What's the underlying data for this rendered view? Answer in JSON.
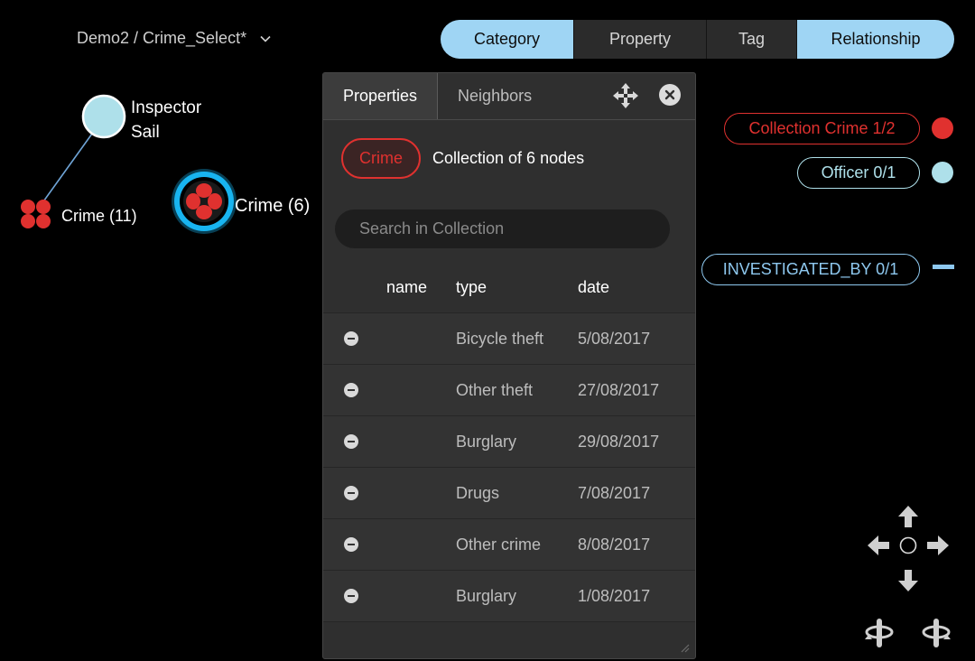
{
  "breadcrumb": {
    "text": "Demo2 / Crime_Select*"
  },
  "topbar": {
    "tabs": [
      {
        "label": "Category",
        "active": true
      },
      {
        "label": "Property",
        "active": false
      },
      {
        "label": "Tag",
        "active": false
      },
      {
        "label": "Relationship",
        "active": true
      }
    ]
  },
  "graph": {
    "inspector_line1": "Inspector",
    "inspector_line2": "Sail",
    "crime_group_label": "Crime (11)",
    "crime_selected_label": "Crime (6)"
  },
  "panel": {
    "tabs": [
      {
        "label": "Properties",
        "active": true
      },
      {
        "label": "Neighbors",
        "active": false
      }
    ],
    "category_pill": "Crime",
    "collection_text": "Collection of 6 nodes",
    "search_placeholder": "Search in Collection",
    "columns": {
      "name": "name",
      "type": "type",
      "date": "date"
    },
    "rows": [
      {
        "name": "",
        "type": "Bicycle theft",
        "date": "5/08/2017"
      },
      {
        "name": "",
        "type": "Other theft",
        "date": "27/08/2017"
      },
      {
        "name": "",
        "type": "Burglary",
        "date": "29/08/2017"
      },
      {
        "name": "",
        "type": "Drugs",
        "date": "7/08/2017"
      },
      {
        "name": "",
        "type": "Other crime",
        "date": "8/08/2017"
      },
      {
        "name": "",
        "type": "Burglary",
        "date": "1/08/2017"
      }
    ]
  },
  "legend": {
    "crime": {
      "label": "Collection Crime 1/2",
      "color": "#e0312f"
    },
    "officer": {
      "label": "Officer 0/1",
      "color": "#aee0ea"
    },
    "relationship": {
      "label": "INVESTIGATED_BY 0/1",
      "color": "#8ec8ef"
    }
  },
  "colors": {
    "accent": "#9fd5f4",
    "crime": "#e0312f",
    "officer": "#aee0ea",
    "selection_ring": "#18b4f0"
  },
  "icons": [
    "chevron-down-icon",
    "move-icon",
    "close-icon",
    "minus-circle-icon",
    "arrow-up-icon",
    "arrow-down-icon",
    "arrow-left-icon",
    "arrow-right-icon",
    "center-icon",
    "rotate-left-icon",
    "rotate-right-icon"
  ]
}
